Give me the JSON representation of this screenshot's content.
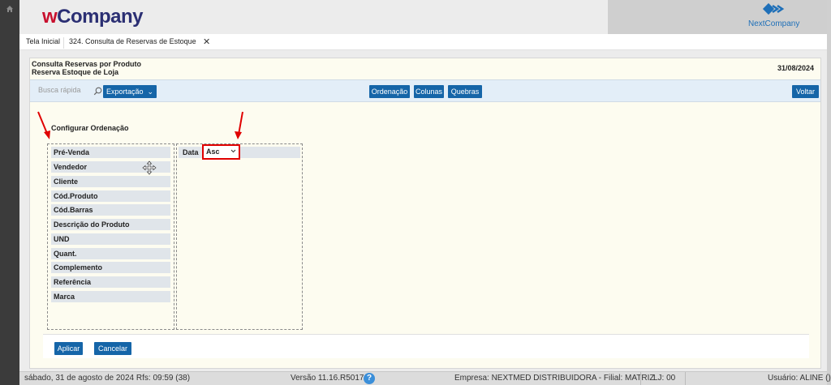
{
  "header": {
    "brand_w": "w",
    "brand_company": "Company",
    "partner_logo": "NextCompany"
  },
  "tabs": [
    {
      "label": "Tela Inicial"
    },
    {
      "label": "324. Consulta de Reservas de Estoque"
    }
  ],
  "report": {
    "title_line1": "Consulta Reservas por Produto",
    "title_line2": "Reserva Estoque de Loja",
    "date": "31/08/2024"
  },
  "toolbar": {
    "search_placeholder": "Busca rápida",
    "export_label": "Exportação",
    "order_label": "Ordenação",
    "columns_label": "Colunas",
    "breaks_label": "Quebras",
    "back_label": "Voltar"
  },
  "config": {
    "title": "Configurar Ordenação",
    "available_fields": [
      "Pré-Venda",
      "Vendedor",
      "Cliente",
      "Cód.Produto",
      "Cód.Barras",
      "Descrição do Produto",
      "UND",
      "Quant.",
      "Complemento",
      "Referência",
      "Marca"
    ],
    "sort_field": "Data",
    "sort_direction": "Asc"
  },
  "actions": {
    "apply_label": "Aplicar",
    "cancel_label": "Cancelar"
  },
  "status": {
    "date_time": "sábado, 31 de agosto de 2024  Rfs: 09:59 (38)",
    "version": "Versão 11.16.R5017",
    "help": "?",
    "company": "Empresa: NEXTMED DISTRIBUIDORA - Filial: MATRIZ",
    "store": "LJ: 00",
    "user": "Usuário: ALINE ()"
  },
  "colors": {
    "primary_button": "#1565a8",
    "highlight": "#e00000",
    "brand_red": "#c8102e",
    "brand_navy": "#2b2f73"
  }
}
